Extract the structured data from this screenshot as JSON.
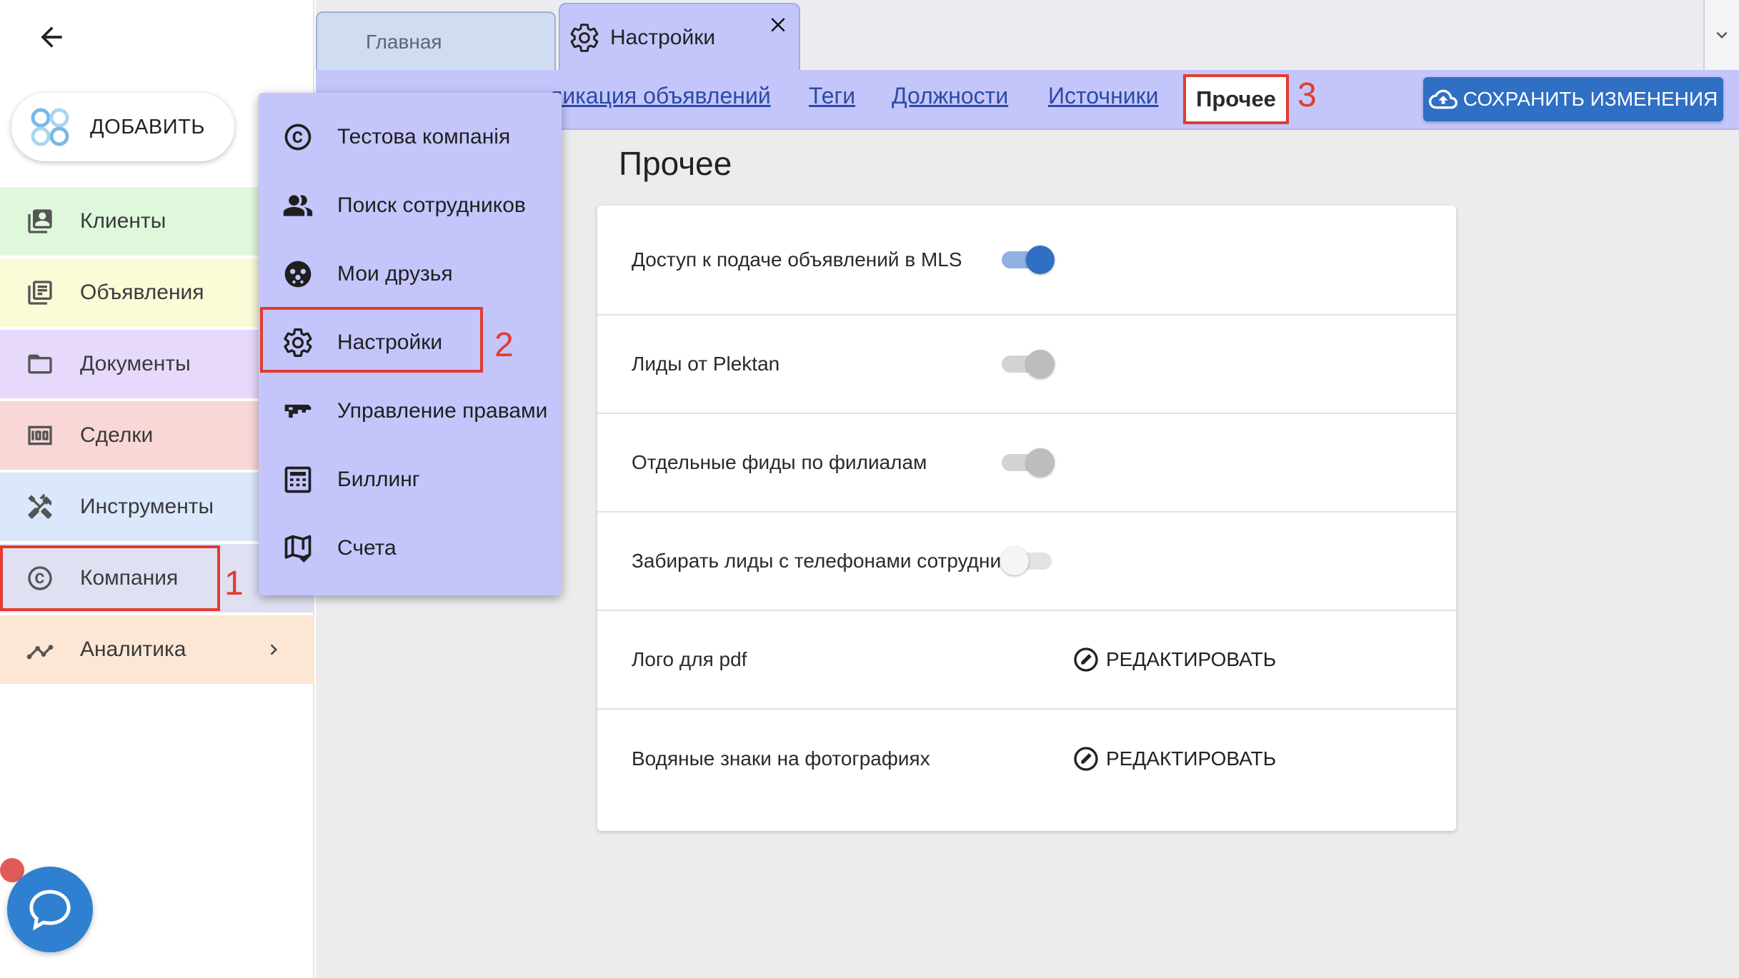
{
  "sidebar": {
    "add_label": "ДОБАВИТЬ",
    "items": [
      {
        "label": "Клиенты",
        "icon": "contacts-icon",
        "bg": "#dff8dc"
      },
      {
        "label": "Объявления",
        "icon": "listings-icon",
        "bg": "#fbfbd8"
      },
      {
        "label": "Документы",
        "icon": "folder-icon",
        "bg": "#e7d9fb"
      },
      {
        "label": "Сделки",
        "icon": "money-icon",
        "bg": "#f9d7d7"
      },
      {
        "label": "Инструменты",
        "icon": "tools-icon",
        "bg": "#dbe7fb"
      },
      {
        "label": "Компания",
        "icon": "copyright-icon",
        "bg": "#e0e0f3"
      },
      {
        "label": "Аналитика",
        "icon": "analytics-icon",
        "bg": "#fbe7d4"
      }
    ]
  },
  "tabs": [
    {
      "label": "Главная"
    },
    {
      "label": "Настройки"
    }
  ],
  "subnav": {
    "links": [
      "Публикация объявлений",
      "Теги",
      "Должности",
      "Источники"
    ],
    "visible_links": [
      "...ликация объявлений",
      "Теги",
      "Должности",
      "Источники"
    ],
    "active": "Прочее",
    "save_label": "СОХРАНИТЬ ИЗМЕНЕНИЯ"
  },
  "markers": {
    "company": "1",
    "settings": "2",
    "other": "3"
  },
  "page": {
    "title": "Прочее",
    "rows": [
      {
        "label": "Доступ к подаче объявлений в MLS",
        "control": "toggle",
        "state": "on"
      },
      {
        "label": "Лиды от Plektan",
        "control": "toggle",
        "state": "disabled"
      },
      {
        "label": "Отдельные фиды по филиалам",
        "control": "toggle",
        "state": "disabled"
      },
      {
        "label": "Забирать лиды с телефонами сотрудников",
        "control": "toggle",
        "state": "off"
      },
      {
        "label": "Лого для pdf",
        "control": "edit",
        "action_label": "РЕДАКТИРОВАТЬ"
      },
      {
        "label": "Водяные знаки на фотографиях",
        "control": "edit",
        "action_label": "РЕДАКТИРОВАТЬ"
      }
    ]
  },
  "menu": {
    "items": [
      {
        "label": "Тестова компанія",
        "icon": "copyright-icon"
      },
      {
        "label": "Поиск сотрудников",
        "icon": "people-icon"
      },
      {
        "label": "Мои друзья",
        "icon": "friends-icon"
      },
      {
        "label": "Настройки",
        "icon": "gear-icon"
      },
      {
        "label": "Управление правами",
        "icon": "key-icon"
      },
      {
        "label": "Биллинг",
        "icon": "calculator-icon"
      },
      {
        "label": "Счета",
        "icon": "map-icon"
      }
    ]
  },
  "colors": {
    "accent": "#2f6fc4",
    "submenu_bg": "#c4c6fb",
    "highlight": "#e33b2f",
    "toggle_on": "#2f6fc4"
  }
}
